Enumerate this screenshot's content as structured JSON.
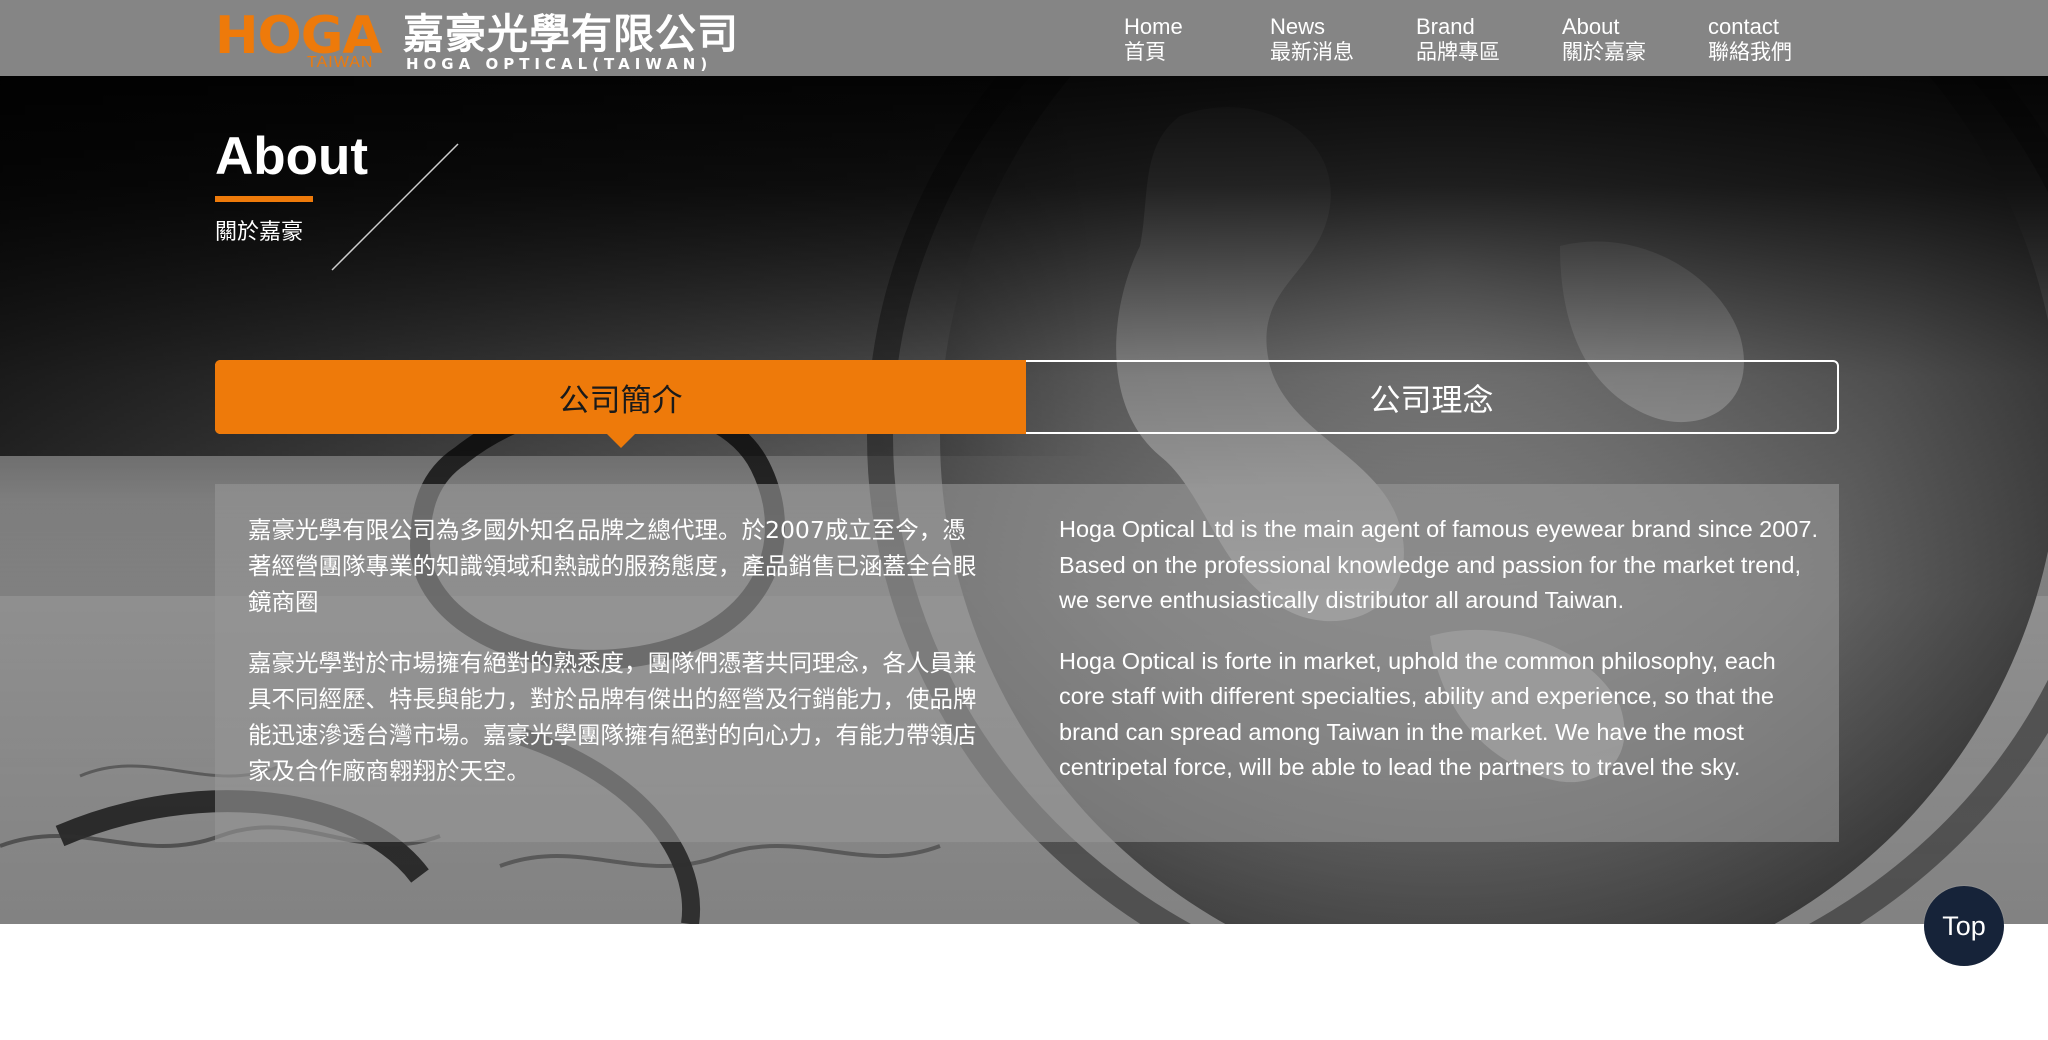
{
  "header": {
    "logo": {
      "brand": "HOGA",
      "region": "TAIWAN",
      "company_cn": "嘉豪光學有限公司",
      "company_en": "HOGA OPTICAL(TAIWAN)"
    },
    "nav": [
      {
        "en": "Home",
        "cn": "首頁"
      },
      {
        "en": "News",
        "cn": "最新消息"
      },
      {
        "en": "Brand",
        "cn": "品牌專區"
      },
      {
        "en": "About",
        "cn": "關於嘉豪"
      },
      {
        "en": "contact",
        "cn": "聯絡我們"
      }
    ]
  },
  "hero": {
    "title": "About",
    "subtitle": "關於嘉豪"
  },
  "tabs": [
    {
      "label": "公司簡介",
      "active": true
    },
    {
      "label": "公司理念",
      "active": false
    }
  ],
  "content": {
    "cn_paragraphs": [
      "嘉豪光學有限公司為多國外知名品牌之總代理。於2007成立至今，憑著經營團隊專業的知識領域和熱誠的服務態度，產品銷售已涵蓋全台眼鏡商圈",
      "嘉豪光學對於市場擁有絕對的熟悉度，團隊們憑著共同理念，各人員兼具不同經歷、特長與能力，對於品牌有傑出的經營及行銷能力，使品牌能迅速滲透台灣市場。嘉豪光學團隊擁有絕對的向心力，有能力帶領店家及合作廠商翱翔於天空。"
    ],
    "en_paragraphs": [
      "Hoga Optical Ltd is the main agent of famous eyewear brand since 2007. Based on the professional knowledge and passion for the market trend, we serve enthusiastically distributor all around Taiwan.",
      "Hoga Optical is forte in market, uphold the common philosophy, each core staff with different specialties, ability and experience, so that the brand can spread among Taiwan in the market. We have the most centripetal force, will be able to lead the partners to travel the sky."
    ]
  },
  "top_button": {
    "label": "Top"
  },
  "colors": {
    "accent": "#ee7a0a",
    "header_bg": "#858585",
    "top_button_bg": "#162339"
  }
}
